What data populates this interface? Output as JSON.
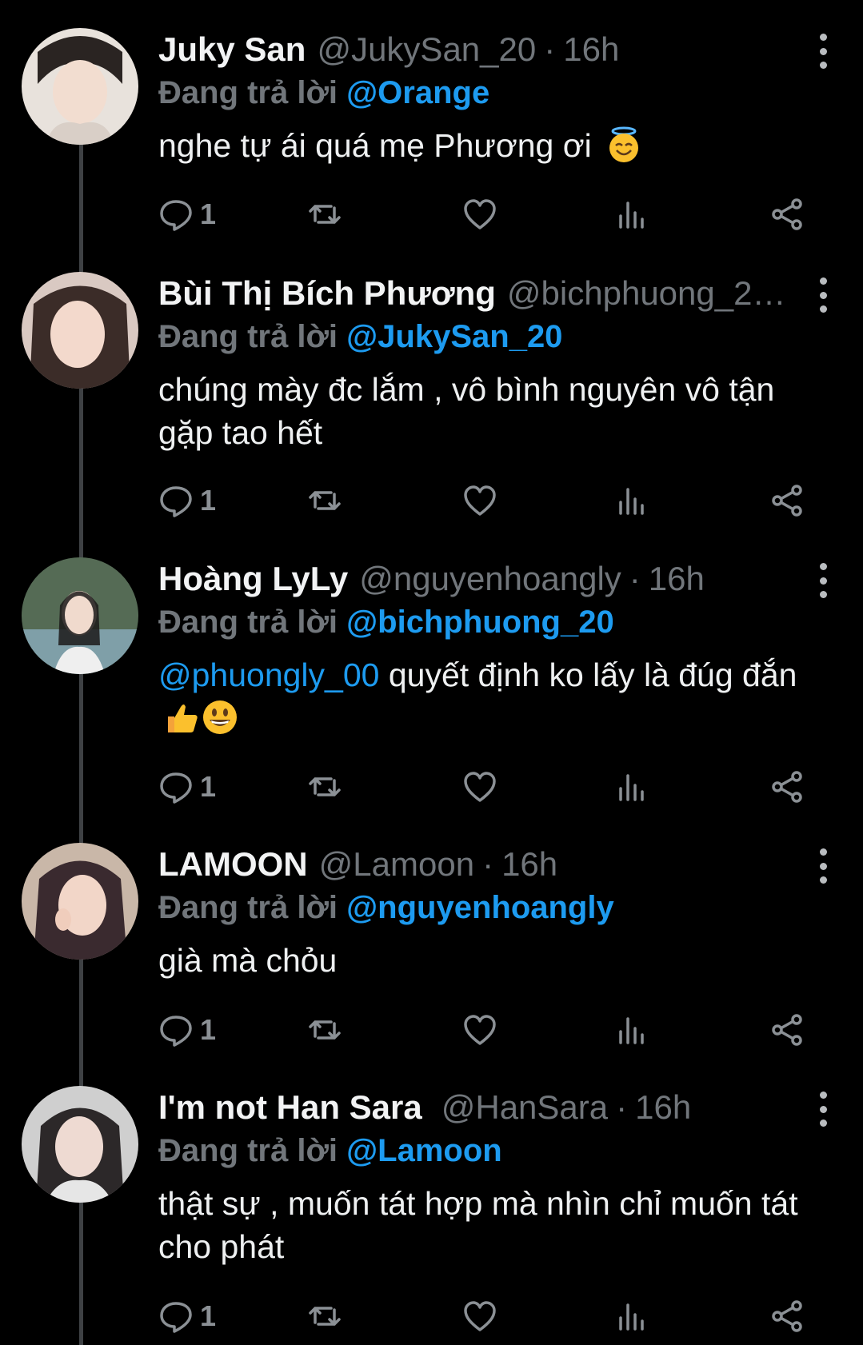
{
  "reply_prefix": "Đang trả lời",
  "colors": {
    "background": "#000000",
    "link": "#1d9bf0",
    "muted": "#71767b"
  },
  "tweets": [
    {
      "name": "Juky San",
      "handle": "@JukySan_20",
      "separator": "·",
      "time": "16h",
      "reply_to": "@Orange",
      "text": "nghe tự ái quá mẹ Phương ơi",
      "emoji": "smiling-face-with-halo",
      "reply_count": "1"
    },
    {
      "name": "Bùi Thị Bích Phương",
      "handle": "@bichphuong_2…",
      "separator": "",
      "time": "",
      "reply_to": "@JukySan_20",
      "text": "chúng mày đc lắm , vô bình nguyên vô tận gặp tao hết",
      "reply_count": "1"
    },
    {
      "name": "Hoàng LyLy",
      "handle": "@nguyenhoangly",
      "separator": "·",
      "time": "16h",
      "reply_to": "@bichphuong_20",
      "mention": "@phuongly_00",
      "text": "quyết định ko lấy là đúg đắn",
      "emoji": "thumbs-up + grinning-face",
      "reply_count": "1"
    },
    {
      "name": "LAMOON",
      "handle": "@Lamoon",
      "separator": "·",
      "time": "16h",
      "reply_to": "@nguyenhoangly",
      "text": "già mà chỏu",
      "reply_count": "1"
    },
    {
      "name": "I'm not Han Sara",
      "handle": "@HanSara",
      "separator": "·",
      "time": "16h",
      "reply_to": "@Lamoon",
      "text": "thật sự , muốn tát hợp mà nhìn chỉ muốn tát cho phát",
      "reply_count": "1"
    }
  ]
}
